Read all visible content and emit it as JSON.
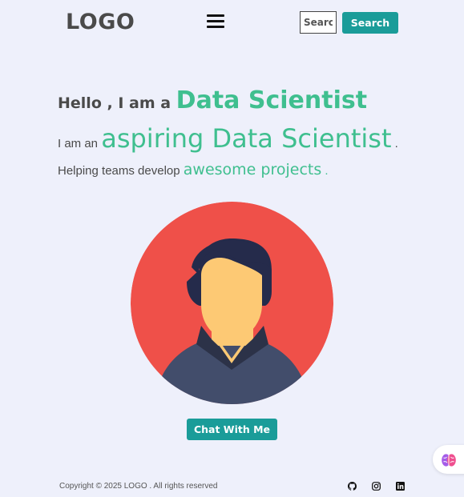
{
  "header": {
    "logo": "LOGO",
    "search_placeholder": "Search",
    "search_button": "Search",
    "menu_icon": "hamburger-menu-icon"
  },
  "hero": {
    "line1_prefix": "Hello , I am a ",
    "line1_highlight": "Data Scientist",
    "line2_prefix": "I am an ",
    "line2_highlight": "aspiring Data Scientist",
    "line2_suffix": " .",
    "line3_prefix": "Helping teams develop ",
    "line3_highlight": "awesome projects",
    "line3_suffix": " .",
    "avatar_icon": "person-avatar-icon",
    "chat_button": "Chat With Me"
  },
  "footer": {
    "copyright": "Copyright © 2025 LOGO . All rights reserved",
    "social_icons": [
      "github-icon",
      "instagram-icon",
      "linkedin-icon"
    ]
  },
  "floating_button_icon": "brain-icon",
  "colors": {
    "background": "#eef0fb",
    "accent_green": "#3fbf8f",
    "button_teal": "#1a9c99",
    "avatar_circle": "#ef5049",
    "text_dark": "#4a4a4a"
  }
}
